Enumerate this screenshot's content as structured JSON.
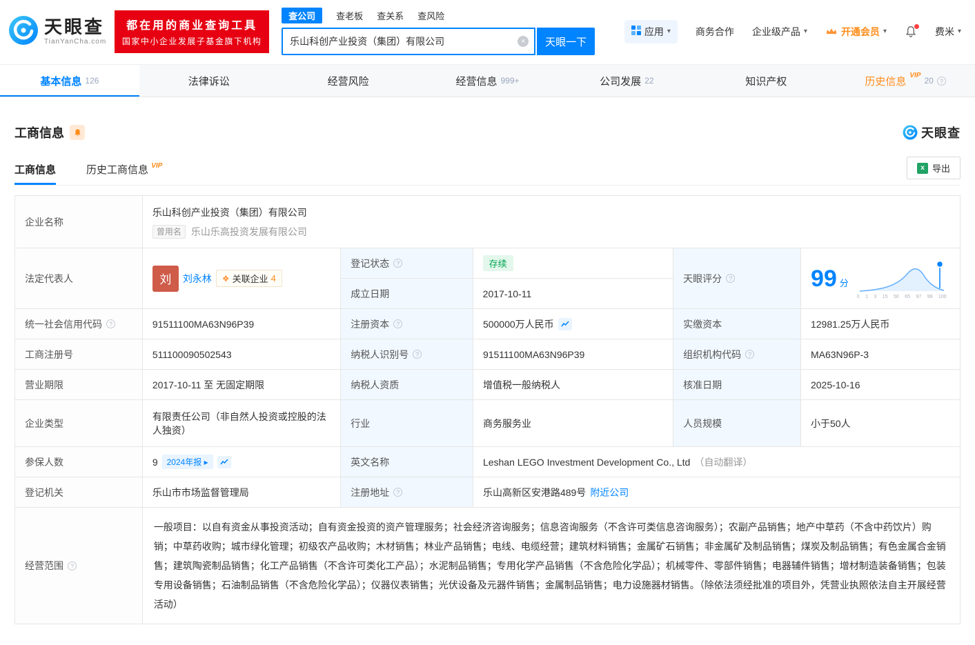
{
  "header": {
    "logo": {
      "name": "天眼查",
      "domain": "TianYanCha.com"
    },
    "banner": {
      "line1": "都在用的商业查询工具",
      "line2": "国家中小企业发展子基金旗下机构"
    },
    "search": {
      "tabs": [
        {
          "label": "查公司"
        },
        {
          "label": "查老板"
        },
        {
          "label": "查关系"
        },
        {
          "label": "查风险"
        }
      ],
      "value": "乐山科创产业投资（集团）有限公司",
      "button": "天眼一下"
    },
    "menu": {
      "apps": "应用",
      "cooperation": "商务合作",
      "enterprise_products": "企业级产品",
      "vip": "开通会员",
      "user": "费米"
    }
  },
  "nav_tabs": [
    {
      "label": "基本信息",
      "count": "126"
    },
    {
      "label": "法律诉讼",
      "count": ""
    },
    {
      "label": "经营风险",
      "count": ""
    },
    {
      "label": "经营信息",
      "count": "999+"
    },
    {
      "label": "公司发展",
      "count": "22"
    },
    {
      "label": "知识产权",
      "count": ""
    },
    {
      "label": "历史信息",
      "count": "20",
      "vip_label": "VIP"
    }
  ],
  "section": {
    "title": "工商信息",
    "brand": "天眼查",
    "subtab_current": "工商信息",
    "subtab_history": "历史工商信息",
    "vip_badge": "VIP",
    "export": "导出"
  },
  "info": {
    "company_name": {
      "label": "企业名称",
      "value": "乐山科创产业投资（集团）有限公司",
      "former_label": "曾用名",
      "former_value": "乐山乐高投资发展有限公司"
    },
    "legal_rep": {
      "label": "法定代表人",
      "avatar": "刘",
      "name": "刘永林",
      "related_label": "关联企业",
      "related_count": "4"
    },
    "reg_status": {
      "label": "登记状态",
      "value": "存续"
    },
    "establish_date": {
      "label": "成立日期",
      "value": "2017-10-11"
    },
    "score": {
      "label": "天眼评分",
      "value": "99",
      "unit": "分",
      "axis": [
        "0",
        "1",
        "3",
        "15",
        "50",
        "65",
        "97",
        "99",
        "100"
      ]
    },
    "credit_code": {
      "label": "统一社会信用代码",
      "value": "91511100MA63N96P39"
    },
    "reg_capital": {
      "label": "注册资本",
      "value": "500000万人民币"
    },
    "paid_capital": {
      "label": "实缴资本",
      "value": "12981.25万人民币"
    },
    "reg_number": {
      "label": "工商注册号",
      "value": "511100090502543"
    },
    "taxpayer_id": {
      "label": "纳税人识别号",
      "value": "91511100MA63N96P39"
    },
    "org_code": {
      "label": "组织机构代码",
      "value": "MA63N96P-3"
    },
    "business_term": {
      "label": "营业期限",
      "value": "2017-10-11 至 无固定期限"
    },
    "taxpayer_quality": {
      "label": "纳税人资质",
      "value": "增值税一般纳税人"
    },
    "approval_date": {
      "label": "核准日期",
      "value": "2025-10-16"
    },
    "company_type": {
      "label": "企业类型",
      "value": "有限责任公司（非自然人投资或控股的法人独资）"
    },
    "industry": {
      "label": "行业",
      "value": "商务服务业"
    },
    "staff_size": {
      "label": "人员规模",
      "value": "小于50人"
    },
    "insured_count": {
      "label": "参保人数",
      "value": "9",
      "badge": "2024年报 ▸"
    },
    "english_name": {
      "label": "英文名称",
      "value": "Leshan LEGO Investment Development Co., Ltd",
      "note": "（自动翻译）"
    },
    "reg_authority": {
      "label": "登记机关",
      "value": "乐山市市场监督管理局"
    },
    "reg_address": {
      "label": "注册地址",
      "value": "乐山高新区安港路489号",
      "link": "附近公司"
    },
    "business_scope": {
      "label": "经营范围",
      "value": "一般项目：以自有资金从事投资活动；自有资金投资的资产管理服务；社会经济咨询服务；信息咨询服务（不含许可类信息咨询服务）；农副产品销售；地产中草药（不含中药饮片）购销；中草药收购；城市绿化管理；初级农产品收购；木材销售；林业产品销售；电线、电缆经营；建筑材料销售；金属矿石销售；非金属矿及制品销售；煤炭及制品销售；有色金属合金销售；建筑陶瓷制品销售；化工产品销售（不含许可类化工产品）；水泥制品销售；专用化学产品销售（不含危险化学品）；机械零件、零部件销售；电器辅件销售；增材制造装备销售；包装专用设备销售；石油制品销售（不含危险化学品）；仪器仪表销售；光伏设备及元器件销售；金属制品销售；电力设施器材销售。（除依法须经批准的项目外，凭营业执照依法自主开展经营活动）"
    }
  }
}
